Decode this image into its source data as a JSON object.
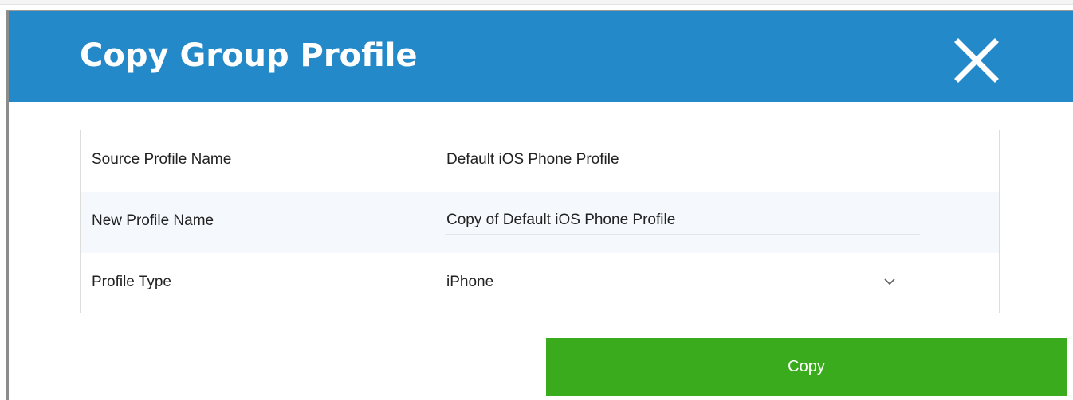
{
  "dialog": {
    "title": "Copy Group Profile",
    "close_icon": "close-icon",
    "header_color": "#2389c9"
  },
  "form": {
    "source_profile": {
      "label": "Source Profile Name",
      "value": "Default iOS Phone Profile"
    },
    "new_profile": {
      "label": "New Profile Name",
      "value": "Copy of Default iOS Phone Profile"
    },
    "profile_type": {
      "label": "Profile Type",
      "selected": "iPhone",
      "icon": "chevron-down-icon"
    }
  },
  "actions": {
    "copy_label": "Copy",
    "copy_color": "#3aab1c"
  }
}
